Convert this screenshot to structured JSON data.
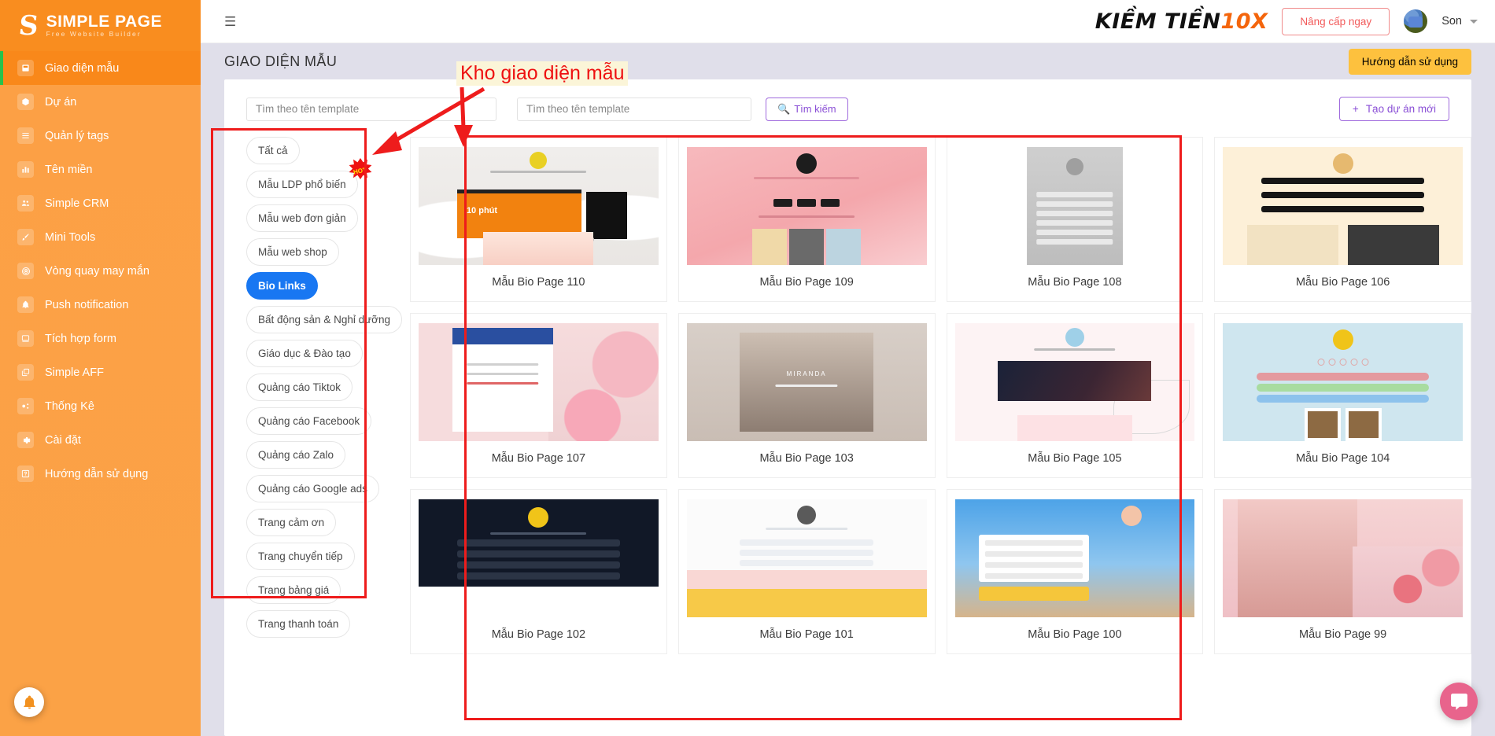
{
  "brand": {
    "title": "SIMPLE PAGE",
    "subtitle": "Free Website Builder",
    "logo_glyph": "S"
  },
  "sidebar": {
    "items": [
      {
        "label": "Giao diện mẫu",
        "icon": "template-icon",
        "active": true
      },
      {
        "label": "Dự án",
        "icon": "box-icon",
        "active": false
      },
      {
        "label": "Quản lý tags",
        "icon": "list-icon",
        "active": false
      },
      {
        "label": "Tên miền",
        "icon": "chart-icon",
        "active": false
      },
      {
        "label": "Simple CRM",
        "icon": "people-icon",
        "active": false
      },
      {
        "label": "Mini Tools",
        "icon": "brush-icon",
        "active": false
      },
      {
        "label": "Vòng quay may mắn",
        "icon": "wheel-icon",
        "active": false
      },
      {
        "label": "Push notification",
        "icon": "bell-icon",
        "active": false
      },
      {
        "label": "Tích hợp form",
        "icon": "form-icon",
        "active": false
      },
      {
        "label": "Simple AFF",
        "icon": "copy-icon",
        "active": false
      },
      {
        "label": "Thống Kê",
        "icon": "stats-icon",
        "active": false
      },
      {
        "label": "Cài đặt",
        "icon": "gear-icon",
        "active": false
      },
      {
        "label": "Hướng dẫn sử dụng",
        "icon": "question-icon",
        "active": false
      }
    ]
  },
  "header": {
    "hamburger": "☰",
    "promo_main": "KIỀM TIỀN",
    "promo_accent": "10X",
    "upgrade_label": "Nâng cấp ngay",
    "user_name": "Son",
    "caret": "▾"
  },
  "page": {
    "title": "GIAO DIỆN MẪU",
    "guide_label": "Hướng dẫn sử dụng"
  },
  "toolbar": {
    "search_placeholder_1": "Tìm theo tên template",
    "search_value_1": "",
    "search_placeholder_2": "Tìm theo tên template",
    "search_value_2": "",
    "search_button_label": "Tìm kiếm",
    "search_icon": "search-icon",
    "create_button_label": "Tạo dự án mới",
    "create_icon": "plus-icon"
  },
  "categories": [
    {
      "label": "Tất cả",
      "active": false,
      "badge": ""
    },
    {
      "label": "Mẫu LDP phổ biến",
      "active": false,
      "badge": "HOT"
    },
    {
      "label": "Mẫu web đơn giản",
      "active": false,
      "badge": ""
    },
    {
      "label": "Mẫu web shop",
      "active": false,
      "badge": ""
    },
    {
      "label": "Bio Links",
      "active": true,
      "badge": ""
    },
    {
      "label": "Bất động sản & Nghỉ dưỡng",
      "active": false,
      "badge": ""
    },
    {
      "label": "Giáo dục & Đào tạo",
      "active": false,
      "badge": ""
    },
    {
      "label": "Quảng cáo Tiktok",
      "active": false,
      "badge": ""
    },
    {
      "label": "Quảng cáo Facebook",
      "active": false,
      "badge": ""
    },
    {
      "label": "Quảng cáo Zalo",
      "active": false,
      "badge": ""
    },
    {
      "label": "Quảng cáo Google ads",
      "active": false,
      "badge": ""
    },
    {
      "label": "Trang cảm ơn",
      "active": false,
      "badge": ""
    },
    {
      "label": "Trang chuyển tiếp",
      "active": false,
      "badge": ""
    },
    {
      "label": "Trang bảng giá",
      "active": false,
      "badge": ""
    },
    {
      "label": "Trang thanh toán",
      "active": false,
      "badge": ""
    }
  ],
  "templates": [
    {
      "label": "Mẫu Bio Page 110",
      "thumb": "th110"
    },
    {
      "label": "Mẫu Bio Page 109",
      "thumb": "th109"
    },
    {
      "label": "Mẫu Bio Page 108",
      "thumb": "th108"
    },
    {
      "label": "Mẫu Bio Page 106",
      "thumb": "th106"
    },
    {
      "label": "Mẫu Bio Page 107",
      "thumb": "th107"
    },
    {
      "label": "Mẫu Bio Page 103",
      "thumb": "th103"
    },
    {
      "label": "Mẫu Bio Page 105",
      "thumb": "th105"
    },
    {
      "label": "Mẫu Bio Page 104",
      "thumb": "th104"
    },
    {
      "label": "Mẫu Bio Page 102",
      "thumb": "th102"
    },
    {
      "label": "Mẫu Bio Page 101",
      "thumb": "th101"
    },
    {
      "label": "Mẫu Bio Page 100",
      "thumb": "th100"
    },
    {
      "label": "Mẫu Bio Page 99",
      "thumb": "th99"
    }
  ],
  "annotations": {
    "callout_text": "Kho giao diện mẫu",
    "highlight_color": "#ee1c1c"
  },
  "widgets": {
    "bell": "bell-icon",
    "chat": "chat-icon"
  },
  "colors": {
    "sidebar": "#fba348",
    "accent_purple": "#8a4fd6",
    "accent_yellow": "#fdc13e",
    "active_blue": "#1877f2",
    "annotation_red": "#ee1c1c"
  }
}
